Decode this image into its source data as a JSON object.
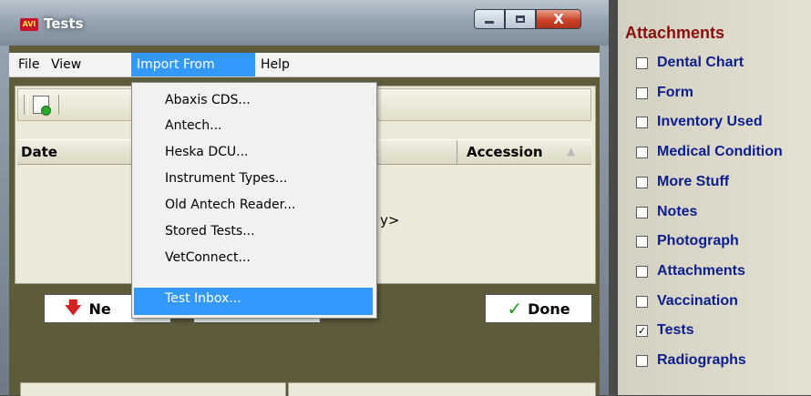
{
  "window": {
    "title": "Tests",
    "app_icon_text": "AVI",
    "close_glyph": "X"
  },
  "menubar": {
    "items": [
      "File",
      "View",
      "Import From",
      "Help"
    ]
  },
  "grid": {
    "columns": [
      "Date",
      "Accession"
    ],
    "empty_text": "y>"
  },
  "import_menu": {
    "items": [
      "Abaxis CDS...",
      "Antech...",
      "Heska DCU...",
      "Instrument Types...",
      "Old Antech Reader...",
      "Stored Tests...",
      "VetConnect...",
      "Test Inbox..."
    ],
    "selected": "Test Inbox..."
  },
  "buttons": {
    "new_label": "Ne",
    "done_label": "Done"
  },
  "attachments": {
    "title": "Attachments",
    "items": [
      {
        "label": "Dental Chart",
        "checked": false
      },
      {
        "label": "Form",
        "checked": false
      },
      {
        "label": "Inventory Used",
        "checked": false
      },
      {
        "label": "Medical Condition",
        "checked": false
      },
      {
        "label": "More Stuff",
        "checked": false
      },
      {
        "label": "Notes",
        "checked": false
      },
      {
        "label": "Photograph",
        "checked": false
      },
      {
        "label": "Attachments",
        "checked": false
      },
      {
        "label": "Vaccination",
        "checked": false
      },
      {
        "label": "Tests",
        "checked": true
      },
      {
        "label": "Radiographs",
        "checked": false
      }
    ]
  },
  "colors": {
    "accent_selection": "#3399ff",
    "attachments_title": "#8b0d0d",
    "attachments_label": "#0a1f8a",
    "client_background": "#5e5b3c"
  }
}
